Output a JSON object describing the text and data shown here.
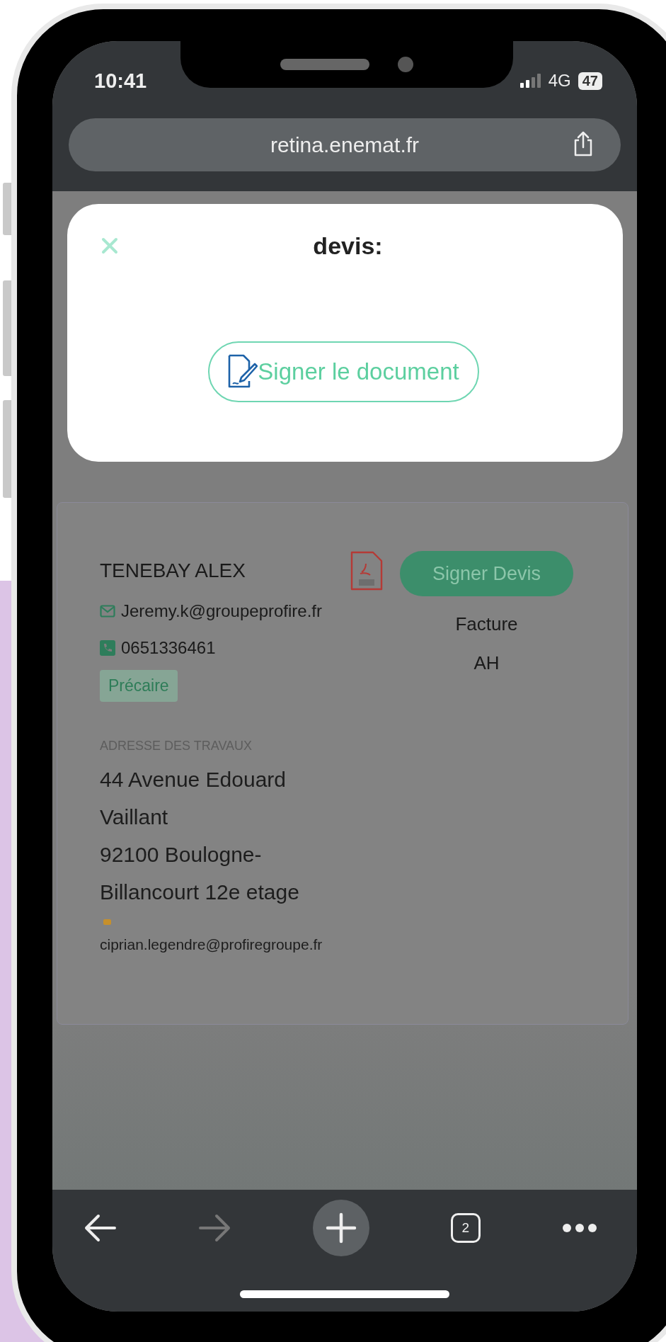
{
  "status_bar": {
    "time": "10:41",
    "network": "4G",
    "battery": "47"
  },
  "address_bar": {
    "url": "retina.enemat.fr"
  },
  "modal": {
    "title": "devis:",
    "button": "Signer le document"
  },
  "card": {
    "name": "TENEBAY ALEX",
    "email": "Jeremy.k@groupeprofire.fr",
    "phone": "0651336461",
    "tag": "Précaire",
    "sign_button": "Signer Devis",
    "links": [
      "Facture",
      "AH"
    ],
    "address_label": "ADRESSE DES TRAVAUX",
    "address_lines": [
      "44 Avenue Edouard",
      "Vaillant",
      "92100 Boulogne-",
      "Billancourt 12e etage"
    ],
    "contact_email": "ciprian.legendre@profiregroupe.fr"
  },
  "toolbar": {
    "buttons": [
      {
        "kind": "back",
        "disabled": false
      },
      {
        "kind": "forward",
        "disabled": true
      },
      {
        "kind": "new-tab",
        "disabled": false
      },
      {
        "kind": "tabs",
        "label": "2",
        "disabled": false
      },
      {
        "kind": "more",
        "disabled": false
      }
    ]
  }
}
